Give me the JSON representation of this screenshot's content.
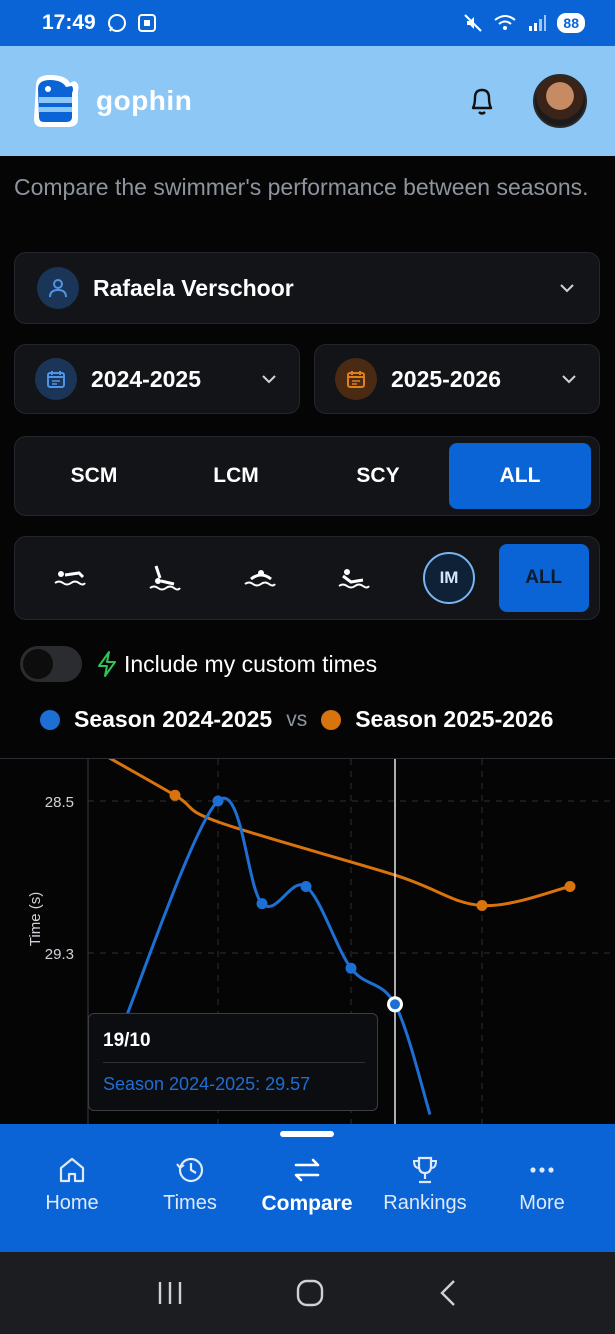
{
  "status_bar": {
    "time": "17:49",
    "battery": "88"
  },
  "header": {
    "brand": "gophin"
  },
  "main": {
    "subtitle": "Compare the swimmer's performance between seasons.",
    "swimmer": "Rafaela Verschoor",
    "season_a": "2024-2025",
    "season_b": "2025-2026",
    "course_tabs": [
      "SCM",
      "LCM",
      "SCY",
      "ALL"
    ],
    "course_active": "ALL",
    "stroke_filters": [
      "freestyle-icon",
      "backstroke-icon",
      "breaststroke-icon",
      "butterfly-icon",
      "IM",
      "ALL"
    ],
    "stroke_im_label": "IM",
    "stroke_all_label": "ALL",
    "toggle_label": "Include my custom times",
    "toggle_on": false,
    "legend": {
      "a": "Season 2024-2025",
      "vs": "vs",
      "b": "Season 2025-2026"
    }
  },
  "colors": {
    "accent": "#0a64d6",
    "season_a": "#1e6fd4",
    "season_b": "#d9730d",
    "header_bg": "#8cc7f6"
  },
  "chart_data": {
    "type": "line",
    "ylabel": "Time (s)",
    "y_ticks": [
      "28.5",
      "29.3"
    ],
    "y_inverted": true,
    "ylim": [
      28.2,
      30.0
    ],
    "series": [
      {
        "name": "Season 2024-2025",
        "values": [
          29.72,
          28.5,
          29.04,
          28.95,
          29.38,
          29.57,
          30.15
        ]
      },
      {
        "name": "Season 2025-2026",
        "values": [
          28.21,
          28.47,
          28.61,
          28.89,
          29.05,
          28.95
        ]
      }
    ],
    "tooltip": {
      "date": "19/10",
      "label": "Season 2024-2025: 29.57"
    }
  },
  "nav": {
    "items": [
      {
        "label": "Home",
        "icon": "home-icon"
      },
      {
        "label": "Times",
        "icon": "history-icon"
      },
      {
        "label": "Compare",
        "icon": "swap-icon"
      },
      {
        "label": "Rankings",
        "icon": "trophy-icon"
      },
      {
        "label": "More",
        "icon": "more-icon"
      }
    ],
    "active": "Compare"
  }
}
